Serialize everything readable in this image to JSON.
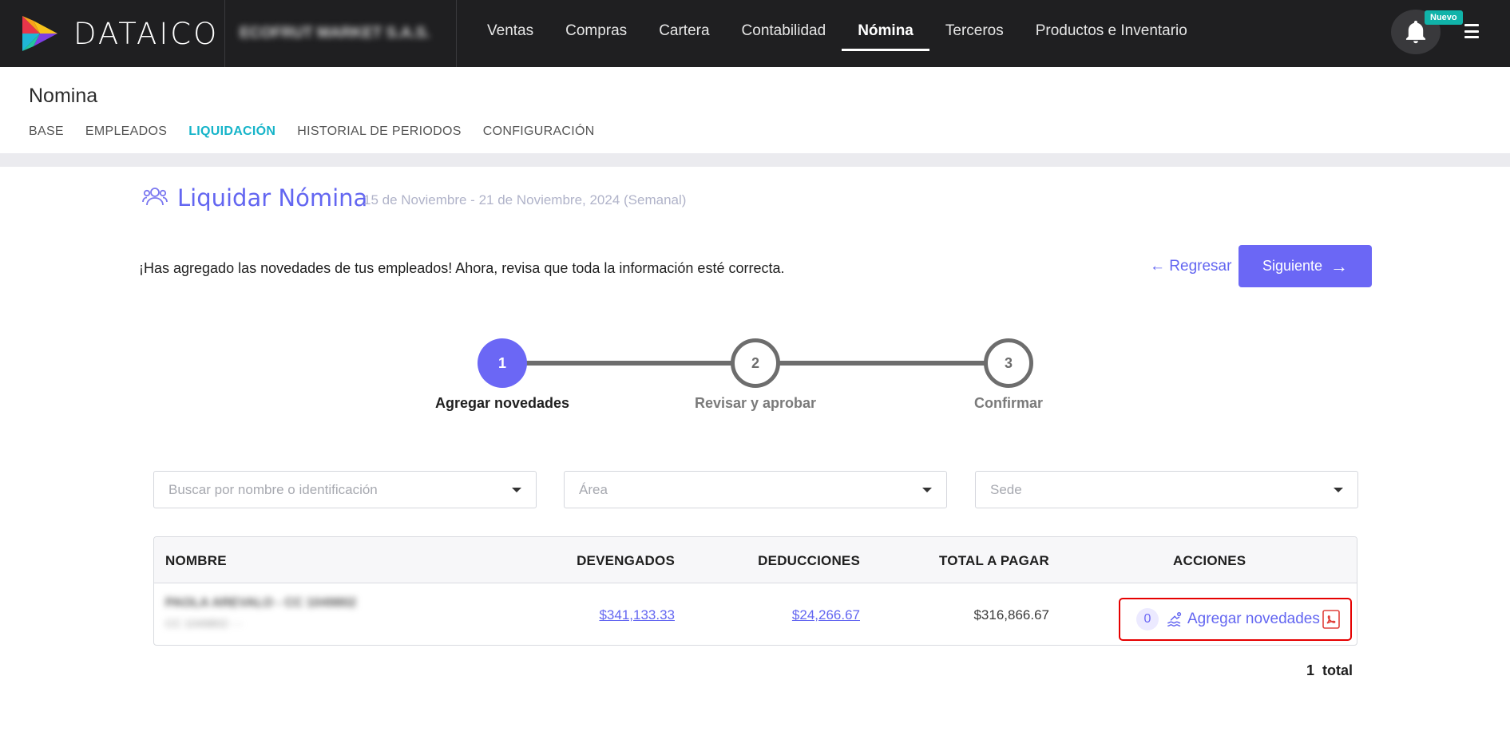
{
  "brand": {
    "name": "DATAICO",
    "company": "ECOFRUT MARKET S.A.S."
  },
  "topnav": {
    "items": [
      "Ventas",
      "Compras",
      "Cartera",
      "Contabilidad",
      "Nómina",
      "Terceros",
      "Productos e Inventario"
    ],
    "active": "Nómina",
    "badge": "Nuevo"
  },
  "subheader": {
    "title": "Nomina",
    "tabs": [
      "BASE",
      "EMPLEADOS",
      "LIQUIDACIÓN",
      "HISTORIAL DE PERIODOS",
      "CONFIGURACIÓN"
    ],
    "active_tab": "LIQUIDACIÓN"
  },
  "section": {
    "title": "Liquidar Nómina",
    "period": "15 de Noviembre - 21 de Noviembre, 2024 (Semanal)",
    "info": "¡Has agregado las novedades de tus empleados! Ahora, revisa que toda la información esté correcta.",
    "back_label": "Regresar",
    "next_label": "Siguiente"
  },
  "stepper": {
    "steps": [
      {
        "number": "1",
        "label": "Agregar novedades",
        "state": "active"
      },
      {
        "number": "2",
        "label": "Revisar y aprobar",
        "state": "pending"
      },
      {
        "number": "3",
        "label": "Confirmar",
        "state": "pending"
      }
    ]
  },
  "filters": {
    "search_placeholder": "Buscar por nombre o identificación",
    "area_placeholder": "Área",
    "sede_placeholder": "Sede"
  },
  "table": {
    "headers": [
      "NOMBRE",
      "DEVENGADOS",
      "DEDUCCIONES",
      "TOTAL A PAGAR",
      "ACCIONES"
    ],
    "rows": [
      {
        "name": "PAOLA AREVALO - CC 1049802",
        "sub": "CC 1049802 - -",
        "devengados": "$341,133.33",
        "deducciones": "$24,266.67",
        "total": "$316,866.67",
        "novedades_count": "0",
        "action_label": "Agregar novedades"
      }
    ]
  },
  "footer": {
    "total_count": "1",
    "total_label": "total"
  },
  "colors": {
    "accent": "#6b67f5",
    "tab_active": "#16b4c9",
    "nav_bg": "#1f1f21",
    "highlight": "#e60000"
  }
}
